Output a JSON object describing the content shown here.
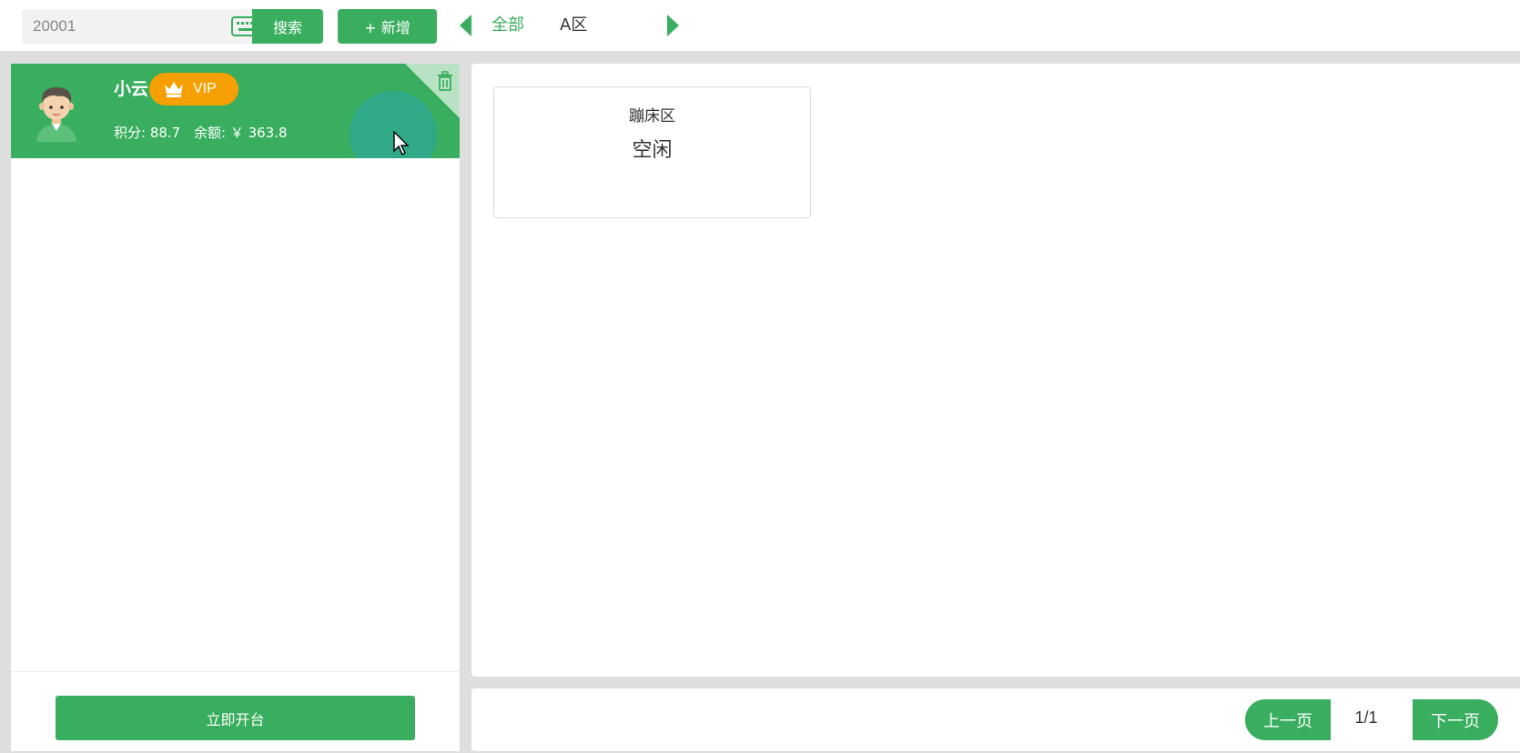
{
  "search": {
    "value": "20001",
    "button_label": "搜索",
    "keyboard_icon": "keyboard-icon"
  },
  "toolbar": {
    "add_label": "+ 新增"
  },
  "area_tabs": [
    {
      "label": "全部",
      "active": true
    },
    {
      "label": "A区",
      "active": false
    }
  ],
  "member": {
    "name": "小云",
    "badge": "VIP",
    "points_label": "积分: 88.7",
    "balance_label": "余额: ￥ 363.8"
  },
  "left_footer": {
    "open_label": "立即开台"
  },
  "tables": [
    {
      "name": "蹦床区",
      "status": "空闲"
    }
  ],
  "pager": {
    "prev_label": "上一页",
    "page": "1/1",
    "next_label": "下一页"
  },
  "colors": {
    "accent": "#38ae5e",
    "vip": "#f5a000"
  }
}
